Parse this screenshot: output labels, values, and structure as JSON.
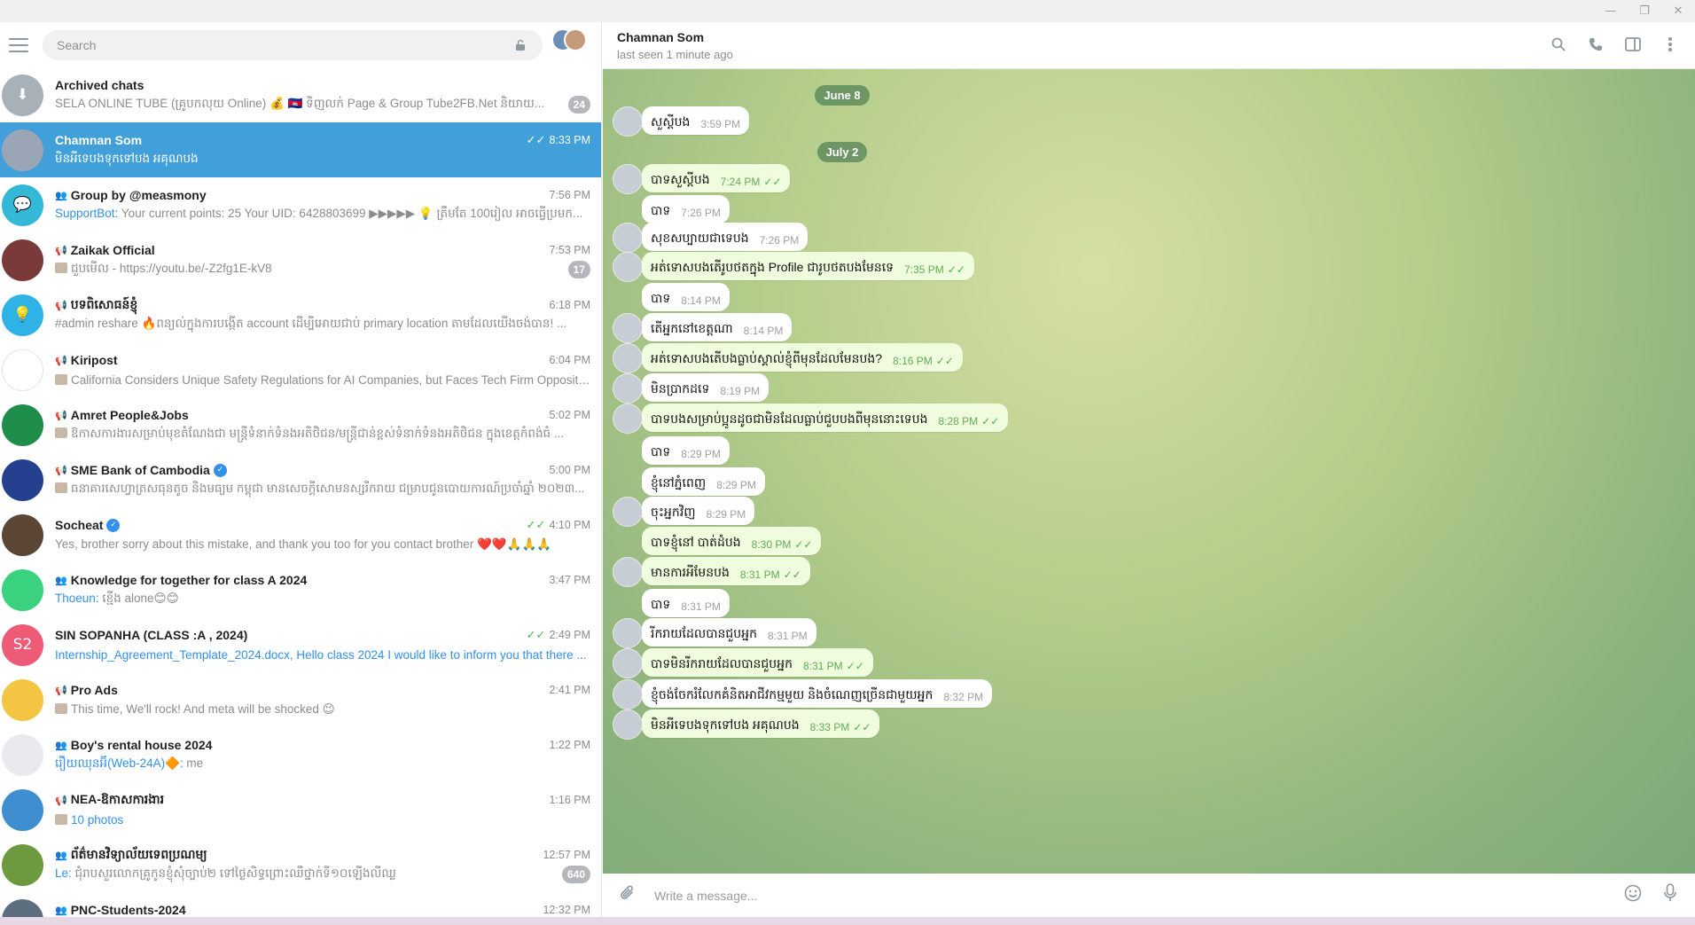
{
  "search": {
    "placeholder": "Search"
  },
  "chats": [
    {
      "name": "Archived chats",
      "time": "",
      "preview": "SELA ONLINE TUBE (គ្រូបកលុយ Online) 💰 🇰🇭 ទិញលក់ Page & Group Tube2FB.Net និយាយ...",
      "sender": "",
      "badge": "24",
      "avatar_color": "#a9b1b8",
      "avatar_text": "⬇"
    },
    {
      "name": "Chamnan Som",
      "time": "8:33 PM",
      "preview": "មិនអីទេបងទុកទៅបង អគុណបង",
      "sender": "",
      "badge": "",
      "avatar_color": "#9aa6b5",
      "avatar_text": ""
    },
    {
      "name": "Group by @measmony",
      "time": "7:56 PM",
      "preview": "Your current points: 25 Your UID: 6428803699 ▶▶▶▶▶ 💡 ត្រឹមតែ 100រៀល អាចធ្វើប្រមក...",
      "sender": "SupportBot: ",
      "badge": "",
      "avatar_color": "#34b8d8",
      "avatar_text": "💬"
    },
    {
      "name": "Zaikak Official",
      "time": "7:53 PM",
      "preview": "ជួបមើល - https://youtu.be/-Z2fg1E-kV8",
      "sender": "",
      "badge": "17",
      "avatar_color": "#7a3a3a",
      "avatar_text": ""
    },
    {
      "name": "បទពិសោធន៍ខ្ញុំ",
      "time": "6:18 PM",
      "preview": "#admin reshare 🔥ពន្យល់ក្នុងការបង្កើត account ដើម្បីអោយជាប់ primary location តាមដែលយើងចង់បាន! ...",
      "sender": "",
      "badge": "",
      "avatar_color": "#2fb3e6",
      "avatar_text": "💡"
    },
    {
      "name": "Kiripost",
      "time": "6:04 PM",
      "preview": "California Considers Unique Safety Regulations for AI Companies, but Faces Tech Firm Opposition...",
      "sender": "",
      "badge": "",
      "avatar_color": "#ffffff",
      "avatar_text": ""
    },
    {
      "name": "Amret People&Jobs",
      "time": "5:02 PM",
      "preview": "ឱកាសការងារសម្រាប់មុខតំណែងជា មន្ត្រីទំនាក់ទំនងអតិថិជន/មន្ត្រីជាន់ខ្ពស់ទំនាក់ទំនងអតិថិជន ក្នុងខេត្តកំពង់ធំ ...",
      "sender": "",
      "badge": "",
      "avatar_color": "#1f8e4a",
      "avatar_text": ""
    },
    {
      "name": "SME Bank of Cambodia",
      "time": "5:00 PM",
      "preview": "ធនាគារសេហ្វាត្រសធុនតូច និងមធ្យម កម្ពុជា មានសេចក្តីសោមនស្សរីករាយ ជម្រាបជូនបោយការណ៍ប្រចាំឆ្នាំ ២០២៣...",
      "sender": "",
      "badge": "",
      "avatar_color": "#25408f",
      "avatar_text": ""
    },
    {
      "name": "Socheat",
      "time": "4:10 PM",
      "preview": "Yes, brother sorry about this mistake, and thank you too for you contact brother ❤️❤️🙏🙏🙏",
      "sender": "",
      "badge": "",
      "avatar_color": "#5b4636",
      "avatar_text": ""
    },
    {
      "name": "Knowledge for together for class A 2024",
      "time": "3:47 PM",
      "preview": "ខ្មើង alone😊😊",
      "sender": "Thoeun: ",
      "badge": "",
      "avatar_color": "#3ad27e",
      "avatar_text": ""
    },
    {
      "name": "SIN SOPANHA (CLASS :A , 2024)",
      "time": "2:49 PM",
      "preview": "Internship_Agreement_Template_2024.docx, Hello class 2024 I would like to inform you that there ...",
      "sender": "",
      "badge": "",
      "avatar_color": "#ee5b76",
      "avatar_text": "S2"
    },
    {
      "name": "Pro Ads",
      "time": "2:41 PM",
      "preview": "This time, We'll rock! And meta will be shocked 😉",
      "sender": "",
      "badge": "",
      "avatar_color": "#f4c542",
      "avatar_text": ""
    },
    {
      "name": "Boy's rental house 2024",
      "time": "1:22 PM",
      "preview": "me",
      "sender": "រឿយឈុនអ៊ី(Web-24A)🔶: ",
      "badge": "",
      "avatar_color": "#e9e9ee",
      "avatar_text": ""
    },
    {
      "name": "NEA-ឱកាសការងារ",
      "time": "1:16 PM",
      "preview": "10 photos",
      "sender": "",
      "badge": "",
      "avatar_color": "#3f8ecf",
      "avatar_text": ""
    },
    {
      "name": "ព័ត៌មានវិទ្យាល័យទេពប្រណម្យ",
      "time": "12:57 PM",
      "preview": "ជុំរាបសួរលោកគ្រូ​កូនខ្ញុំសុំច្បាប់២ ទៅថ្ងៃសិទ្ធព្រោះឈឺថ្នាក់ទី១០ឡើងលីឈ្ល",
      "sender": "Le: ",
      "badge": "640",
      "avatar_color": "#6e9a3f",
      "avatar_text": ""
    },
    {
      "name": "PNC-Students-2024",
      "time": "12:32 PM",
      "preview": "",
      "sender": "",
      "badge": "",
      "avatar_color": "#5d6e80",
      "avatar_text": ""
    }
  ],
  "peer": {
    "name": "Chamnan Som",
    "status": "last seen 1 minute ago"
  },
  "dates": [
    "June 8",
    "July 2"
  ],
  "messages": [
    {
      "text": "សួស្ដីបង",
      "time": "3:59 PM",
      "out": false,
      "avatar": true
    },
    {
      "text": "បាទសួស្ដីបង",
      "time": "7:24 PM",
      "out": true,
      "avatar": true
    },
    {
      "text": "បាទ",
      "time": "7:26 PM",
      "out": false,
      "avatar": false
    },
    {
      "text": "សុខសប្បាយជាទេបង",
      "time": "7:26 PM",
      "out": false,
      "avatar": true
    },
    {
      "text": "អត់ទោសបងតើរូបថតក្នុង Profile ជារូបថតបងមែនទេ",
      "time": "7:35 PM",
      "out": true,
      "avatar": true
    },
    {
      "text": "បាទ",
      "time": "8:14 PM",
      "out": false,
      "avatar": false
    },
    {
      "text": "តើអ្នកនៅខេត្តណា",
      "time": "8:14 PM",
      "out": false,
      "avatar": true
    },
    {
      "text": "អត់ទោសបងតើបងធ្លាប់ស្គាល់ខ្ញុំពីមុនដែលមែនបង?",
      "time": "8:16 PM",
      "out": true,
      "avatar": true
    },
    {
      "text": "មិនប្រាកដទេ",
      "time": "8:19 PM",
      "out": false,
      "avatar": true
    },
    {
      "text": "បាទបងសម្រាប់ប្អូនដូចជាមិនដែលធ្លាប់ជួបបងពីមុននោះទេបង",
      "time": "8:28 PM",
      "out": true,
      "avatar": true
    },
    {
      "text": "បាទ",
      "time": "8:29 PM",
      "out": false,
      "avatar": false
    },
    {
      "text": "ខ្ញុំនៅភ្នំពេញ",
      "time": "8:29 PM",
      "out": false,
      "avatar": false
    },
    {
      "text": "ចុះអ្នកវិញ",
      "time": "8:29 PM",
      "out": false,
      "avatar": true
    },
    {
      "text": "បាទខ្ញុំនៅ បាត់ដំបង",
      "time": "8:30 PM",
      "out": true,
      "avatar": false
    },
    {
      "text": "មានការអីមែនបង",
      "time": "8:31 PM",
      "out": true,
      "avatar": true
    },
    {
      "text": "បាទ",
      "time": "8:31 PM",
      "out": false,
      "avatar": false
    },
    {
      "text": "រីករាយដែលបានជួបអ្នក",
      "time": "8:31 PM",
      "out": false,
      "avatar": true
    },
    {
      "text": "បាទមិនរីករាយដែលបានជួបអ្នក",
      "time": "8:31 PM",
      "out": true,
      "avatar": true
    },
    {
      "text": "ខ្ញុំចង់ចែករំលែកគំនិតអាជីវកម្មមួយ និងចំណេញច្រើនជាមួយអ្នក",
      "time": "8:32 PM",
      "out": false,
      "avatar": true
    },
    {
      "text": "មិនអីទេបងទុកទៅបង អគុណបង",
      "time": "8:33 PM",
      "out": true,
      "avatar": true
    }
  ],
  "composer": {
    "placeholder": "Write a message..."
  }
}
